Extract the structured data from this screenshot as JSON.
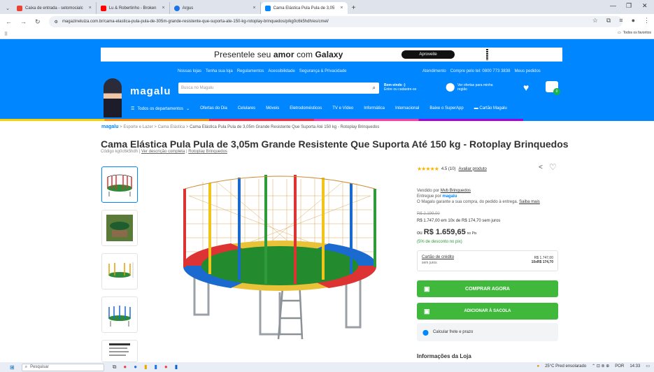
{
  "browser": {
    "tabs": [
      {
        "label": "Caixa de entrada - setomocialc",
        "color": "#ea4335",
        "active": false
      },
      {
        "label": "Lu & Robertinho - Broken",
        "color": "#ff0000",
        "active": false
      },
      {
        "label": "Argus",
        "color": "#1a73e8",
        "active": false
      },
      {
        "label": "Cama Elástica Pula Pula de 3,05",
        "color": "#0086ff",
        "active": true
      }
    ],
    "url": "magazineluiza.com.br/cama-elastica-pula-pula-de-305m-grande-resistente-que-suporta-ate-150-kg-rotoplay-brinquedos/p/kg0c6k5hdh/es/cmel/",
    "all_bookmarks": "Todos os favoritos"
  },
  "promo": {
    "text_pre": "Presentele seu ",
    "text_bold1": "amor",
    "text_mid": " com ",
    "text_bold2": "Galaxy",
    "button": "Aproveite"
  },
  "header": {
    "toplinks_left": [
      "Nossas lojas",
      "Tenha sua loja",
      "Regulamentos",
      "Acessibilidade",
      "Segurança & Privacidade"
    ],
    "toplinks_right": [
      "Atendimento",
      "Compre pelo tel: 0800 773 3838",
      "Meus pedidos"
    ],
    "logo": "magalu",
    "search_placeholder": "Busca no Magalu",
    "login_line1": "Bem-vindo :)",
    "login_line2": "Entre ou cadastre-se",
    "offers_line1": "Ver ofertas para minha",
    "offers_line2": "região",
    "cart_count": "0",
    "departments": [
      "Todos os departamentos",
      "Ofertas do Dia",
      "Celulares",
      "Móveis",
      "Eletrodomésticos",
      "TV e Vídeo",
      "Informática",
      "Internacional",
      "Baixe o SuperApp",
      "Cartão Magalu"
    ]
  },
  "breadcrumb": {
    "brand": "magalu",
    "items": [
      "Esporte e Lazer",
      "Cama Elástica"
    ],
    "current": "Cama Elástica Pula Pula de 3,05m Grande Resistente Que Suporta Até 150 kg - Rotoplay Brinquedos"
  },
  "product": {
    "title": "Cama Elástica Pula Pula de 3,05m Grande Resistente Que Suporta Até 150 kg - Rotoplay Brinquedos",
    "code": "Código kg0c6k5hdh |",
    "desc_link": "Ver descrição completa",
    "brand_link": "Rotoplay Brinquedos",
    "rating": "4.5 (10)",
    "rating_value": 4.5,
    "rate_link": "Avaliar produto",
    "sold_by_label": "Vendido por",
    "seller": "Mvb Brinquedos",
    "delivered_by_label": "Entregue por",
    "delivered_by": "magalu",
    "guarantee": "O Magalu garante a sua compra, do pedido à entrega.",
    "more_link": "Saiba mais",
    "old_price": "R$ 2.199,00",
    "installments": "R$ 1.747,00 em 10x de R$ 174,70 sem juros",
    "pix_prefix": "ou",
    "pix_price": "R$ 1.659,65",
    "pix_suffix": "no Pix",
    "discount": "(5% de desconto no pix)",
    "card_label": "Cartão de crédito",
    "card_sub": "sem juros",
    "card_total": "R$ 1.747,00",
    "card_inst": "10xR$ 174,70",
    "buy_button": "COMPRAR AGORA",
    "cart_button": "ADICIONAR À SACOLA",
    "shipping": "Calcular frete e prazo",
    "store_info": "Informações da Loja"
  },
  "taskbar": {
    "search_placeholder": "Pesquisar",
    "weather": "25°C  Pred ensolarado",
    "lang": "POR",
    "time": "14:33"
  },
  "colors": {
    "brand_blue": "#0086ff",
    "buy_green": "#3fb83c",
    "star": "#f5b400"
  }
}
